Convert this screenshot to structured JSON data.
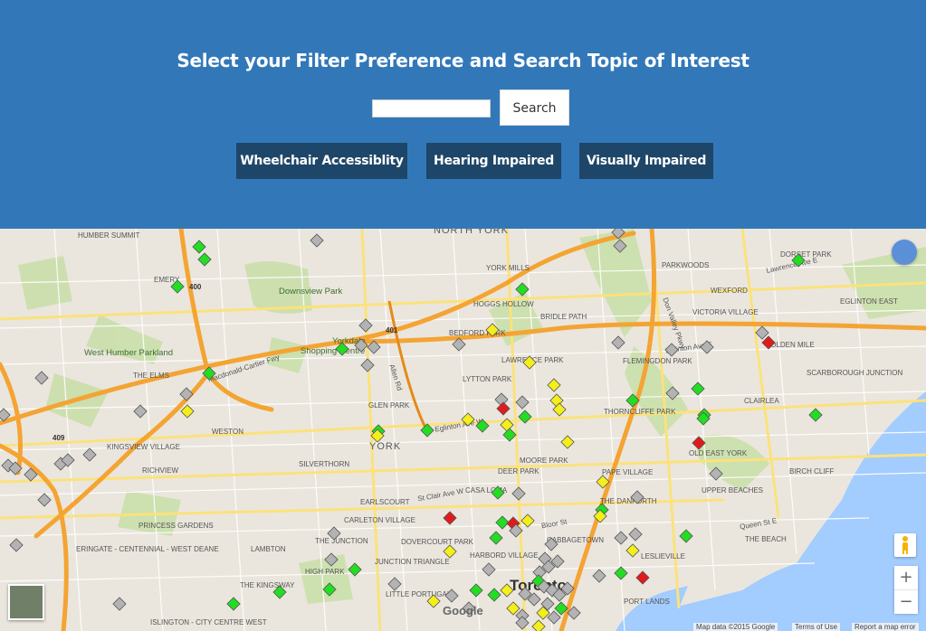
{
  "header": {
    "title": "Select your Filter Preference and Search Topic of Interest",
    "search_value": "",
    "search_button": "Search",
    "filters": [
      "Wheelchair Accessiblity",
      "Hearing Impaired",
      "Visually Impaired"
    ]
  },
  "map": {
    "labels": {
      "north_york": "NORTH YORK",
      "york": "YORK",
      "toronto": "Toronto",
      "downsview_park": "Downsview Park",
      "west_humber_parkland": "West Humber Parkland",
      "shopping_centre": "Shopping Centre",
      "yorkdale": "Yorkdale",
      "york_mills": "YORK MILLS",
      "hoggs_hollow": "HOGGS HOLLOW",
      "bedford_park": "BEDFORD PARK",
      "lawrence_park": "LAWRENCE PARK",
      "lytton_park": "LYTTON PARK",
      "glen_park": "GLEN PARK",
      "westwood": "WESTON",
      "deer_park": "DEER PARK",
      "casa_loma": "CASA LOMA",
      "cabbagetown": "CABBAGETOWN",
      "leslieville": "LESLIEVILLE",
      "the_beach": "THE BEACH",
      "east_york": "OLD EAST YORK",
      "parkwoods": "PARKWOODS",
      "wexford": "WEXFORD",
      "dorset_park": "DORSET PARK",
      "eglinton_east": "EGLINTON EAST",
      "birch_cliff": "BIRCH CLIFF",
      "upper_beaches": "UPPER BEACHES",
      "port_lands": "PORT LANDS",
      "little_portugal": "LITTLE PORTUGAL",
      "high_park": "HIGH PARK",
      "the_kingsway": "THE KINGSWAY",
      "lambton": "LAMBTON",
      "humber_summit": "HUMBER SUMMIT",
      "emery": "EMERY",
      "elms": "THE ELMS",
      "kingsview_village": "KINGSVIEW VILLAGE",
      "richview": "RICHVIEW",
      "princess_gardens": "PRINCESS GARDENS",
      "eringate": "ERINGATE - CENTENNIAL - WEST DEANE",
      "islington": "ISLINGTON - CITY CENTRE WEST",
      "silverthorn": "SILVERTHORN",
      "carleton_village": "CARLETON VILLAGE",
      "dovercourt_park": "DOVERCOURT PARK",
      "harbord_village": "HARBORD VILLAGE",
      "junction_triangle": "JUNCTION TRIANGLE",
      "the_junction": "THE JUNCTION",
      "earlscourt": "EARLSCOURT",
      "moore_park": "MOORE PARK",
      "flemingdon_park": "FLEMINGDON PARK",
      "thorncliffe_park": "THORNCLIFFE PARK",
      "the_danforth": "THE DANFORTH",
      "pape_village": "PAPE VILLAGE",
      "bridle_path": "BRIDLE PATH",
      "victoria_village": "VICTORIA VILLAGE",
      "golden_mile": "GOLDEN MILE",
      "clairlea": "CLAIRLEA",
      "scarborough_junction": "SCARBOROUGH JUNCTION",
      "hwy_401": "401",
      "hwy_400": "400",
      "hwy_409": "409",
      "dvp": "Don Valley Pkwy",
      "allen_rd": "Allen Rd",
      "eglinton_ave_w": "Eglinton Ave W",
      "eglinton_ave_e": "Eglinton Ave E",
      "lawrence_ave_e": "Lawrence Ave E",
      "queen_st_e": "Queen St E",
      "bloor_st": "Bloor St",
      "st_clair_ave_w": "St Clair Ave W",
      "macdonald_cartier": "Macdonald-Cartier Fwy"
    },
    "marker_colors": {
      "green": "#22dd22",
      "yellow": "#f4ee1a",
      "red": "#e11b1b",
      "gray": "#b3b3b3"
    },
    "footer": {
      "map_data": "Map data ©2015 Google",
      "terms": "Terms of Use",
      "report": "Report a map error",
      "google": "Google"
    },
    "controls": {
      "zoom_in": "+",
      "zoom_out": "−"
    }
  }
}
